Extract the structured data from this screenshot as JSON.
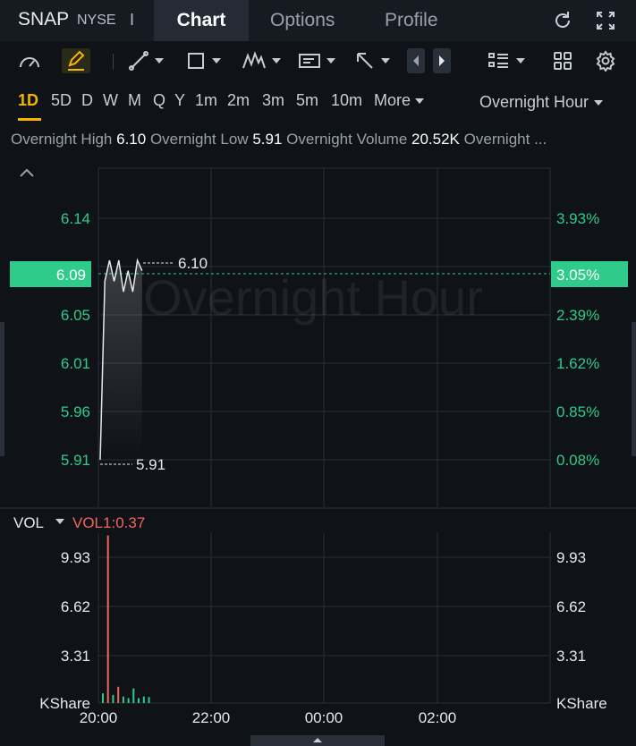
{
  "header": {
    "symbol": "SNAP",
    "exchange": "NYSE",
    "separator": "I",
    "tabs": [
      {
        "label": "Chart",
        "active": true
      },
      {
        "label": "Options",
        "active": false
      },
      {
        "label": "Profile",
        "active": false
      }
    ],
    "icons": [
      "refresh-icon",
      "fullscreen-icon"
    ]
  },
  "toolbar": {
    "icons": [
      "speedometer-icon",
      "draw-pen-icon",
      "line-tool-icon",
      "rectangle-tool-icon",
      "pattern-tool-icon",
      "text-tool-icon",
      "arrow-tool-icon",
      "prev-icon",
      "next-icon",
      "layout-list-icon",
      "grid-icon",
      "settings-icon"
    ],
    "active_tool": "draw-pen-icon"
  },
  "periods": {
    "items": [
      "1D",
      "5D",
      "D",
      "W",
      "M",
      "Q",
      "Y",
      "1m",
      "2m",
      "3m",
      "5m",
      "10m"
    ],
    "active": "1D",
    "more_label": "More",
    "session_label": "Overnight Hour",
    "accent": "#f5b400"
  },
  "stats": {
    "high_label": "Overnight High",
    "high_value": "6.10",
    "low_label": "Overnight Low",
    "low_value": "5.91",
    "volume_label": "Overnight Volume",
    "volume_value": "20.52K",
    "overflow_label": "Overnight ..."
  },
  "chart": {
    "watermark": "Overnight Hour",
    "collapse_icon": "chevron-up-icon",
    "price_ticks": [
      "6.14",
      "6.05",
      "6.01",
      "5.96",
      "5.91"
    ],
    "pct_ticks": [
      "3.93%",
      "2.39%",
      "1.62%",
      "0.85%",
      "0.08%"
    ],
    "current_price": "6.09",
    "current_pct": "3.05%",
    "high_marker": "6.10",
    "low_marker": "5.91",
    "volume_indicator": "VOL",
    "volume_value_label": "VOL1:0.37",
    "volume_ticks": [
      "9.93",
      "6.62",
      "3.31"
    ],
    "volume_unit": "KShare",
    "time_labels": [
      "20:00",
      "22:00",
      "00:00",
      "02:00"
    ],
    "up_color": "#2fcb8b",
    "down_color": "#f0675b"
  },
  "chart_data": {
    "type": "line",
    "price": {
      "x": [
        "20:00",
        "20:05",
        "20:10",
        "20:15",
        "20:20",
        "20:25",
        "20:30",
        "20:35",
        "20:40",
        "20:45"
      ],
      "y": [
        5.91,
        6.08,
        6.1,
        6.08,
        6.1,
        6.07,
        6.09,
        6.07,
        6.1,
        6.09
      ],
      "ylim": [
        5.9,
        6.16
      ]
    },
    "volume": {
      "x": [
        "20:00",
        "20:05",
        "20:10",
        "20:15",
        "20:20",
        "20:25",
        "20:30",
        "20:35",
        "20:40",
        "20:45"
      ],
      "values": [
        0.6,
        10.3,
        0.5,
        1.0,
        0.4,
        0.3,
        0.9,
        0.3,
        0.4,
        0.37
      ],
      "ylim": [
        0,
        10.5
      ],
      "unit": "KShare"
    },
    "x_ticks": [
      "20:00",
      "22:00",
      "00:00",
      "02:00"
    ]
  }
}
